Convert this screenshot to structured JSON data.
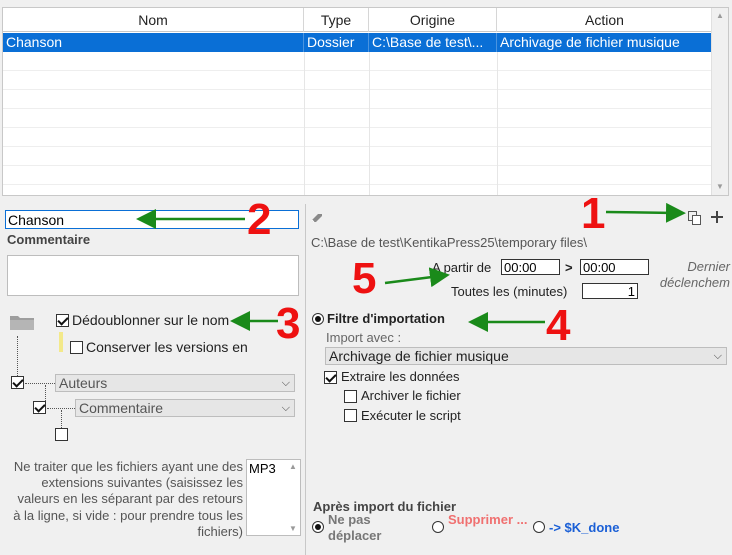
{
  "table": {
    "columns": [
      "Nom",
      "Type",
      "Origine",
      "Action"
    ],
    "rows": [
      {
        "nom": "Chanson",
        "type": "Dossier",
        "origine": "C:\\Base de test\\...",
        "action": "Archivage de fichier musique"
      }
    ]
  },
  "left": {
    "name_value": "Chanson",
    "comment_label": "Commentaire",
    "comment_value": "",
    "dedup_label": "Dédoublonner sur le nom",
    "keep_versions_label": "Conserver les versions en",
    "select_authors": "Auteurs",
    "select_comment": "Commentaire",
    "extensions_note": "Ne traiter que les fichiers ayant une des extensions suivantes (saisissez les valeurs en les séparant par des retours à la ligne, si vide : pour prendre tous les fichiers)",
    "extensions_value": "MP3"
  },
  "right": {
    "path": "C:\\Base de test\\KentikaPress25\\temporary files\\",
    "from_label": "A partir de",
    "from_value": "00:00",
    "gt": ">",
    "to_value": "00:00",
    "every_label": "Toutes les (minutes)",
    "every_value": "1",
    "last_trigger": "Dernier déclenchem",
    "filter_label": "Filtre d'importation",
    "import_with_label": "Import avec :",
    "import_with_value": "Archivage de fichier musique",
    "extract_label": "Extraire les données",
    "archive_label": "Archiver le fichier",
    "script_label": "Exécuter le script",
    "after_import_label": "Après import du fichier",
    "opt_no_move": "Ne pas déplacer",
    "opt_delete": "Supprimer ...",
    "opt_kdone": "-> $K_done"
  },
  "annotations": [
    "1",
    "2",
    "3",
    "4",
    "5"
  ],
  "colors": {
    "selection": "#0a6fd6",
    "annotation": "#ee1111",
    "arrow": "#1a8a1a",
    "delete_option": "#f07070",
    "kdone_option": "#1a5fd6"
  },
  "icons": [
    "duplicate-icon",
    "plus-icon",
    "eraser-icon",
    "folder-icon"
  ]
}
